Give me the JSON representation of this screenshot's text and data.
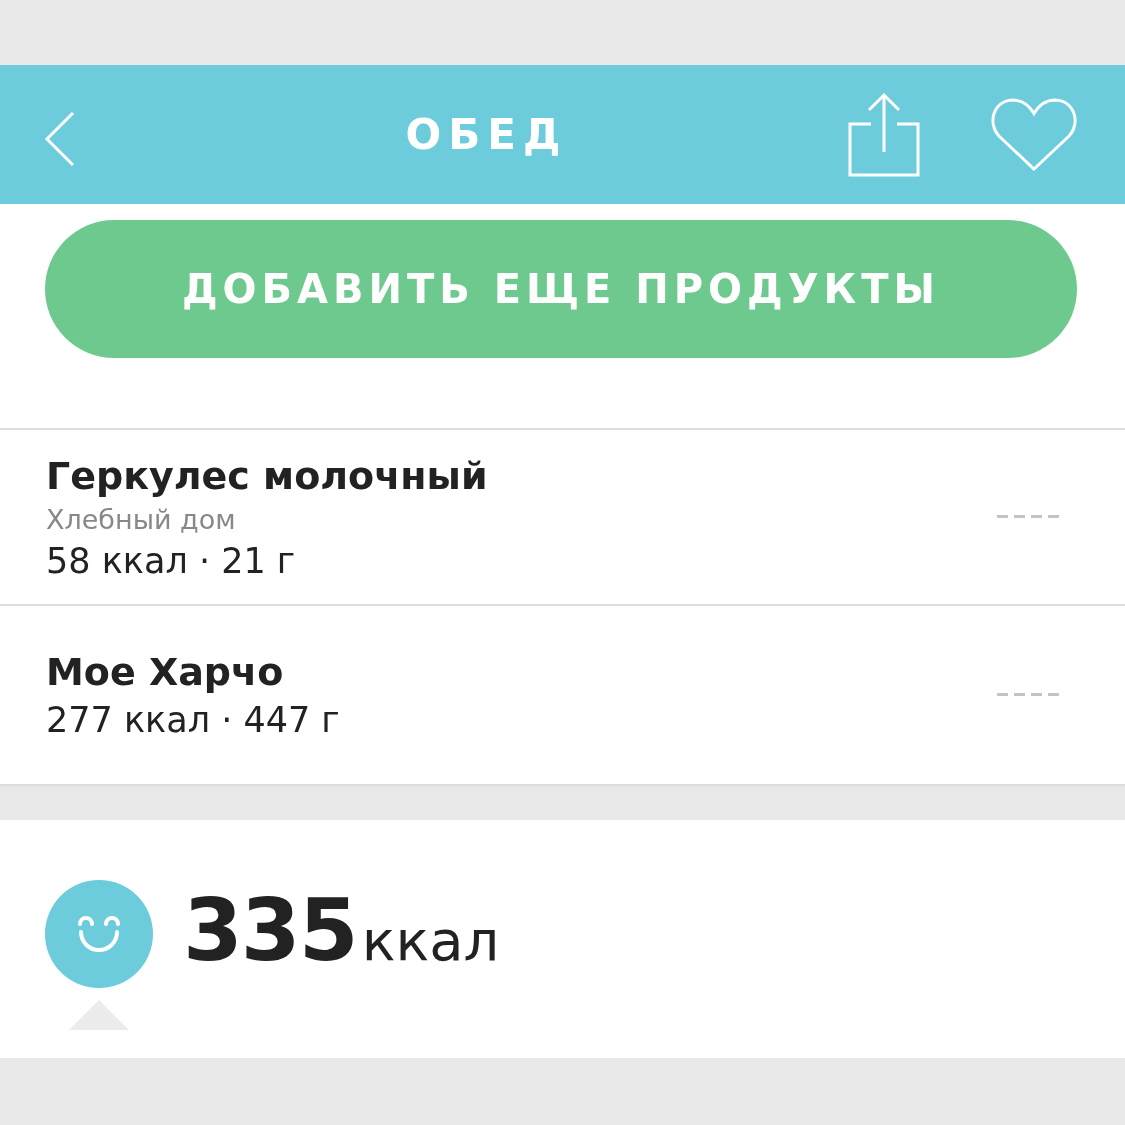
{
  "header": {
    "title": "ОБЕД"
  },
  "add_button": {
    "label": "ДОБАВИТЬ ЕЩЕ ПРОДУКТЫ"
  },
  "items": [
    {
      "name": "Геркулес молочный",
      "brand": "Хлебный дом",
      "summary": "58 ккал · 21 г"
    },
    {
      "name": "Мое Харчо",
      "summary": "277 ккал · 447 г"
    }
  ],
  "total": {
    "value": "335",
    "unit": "ккал"
  }
}
